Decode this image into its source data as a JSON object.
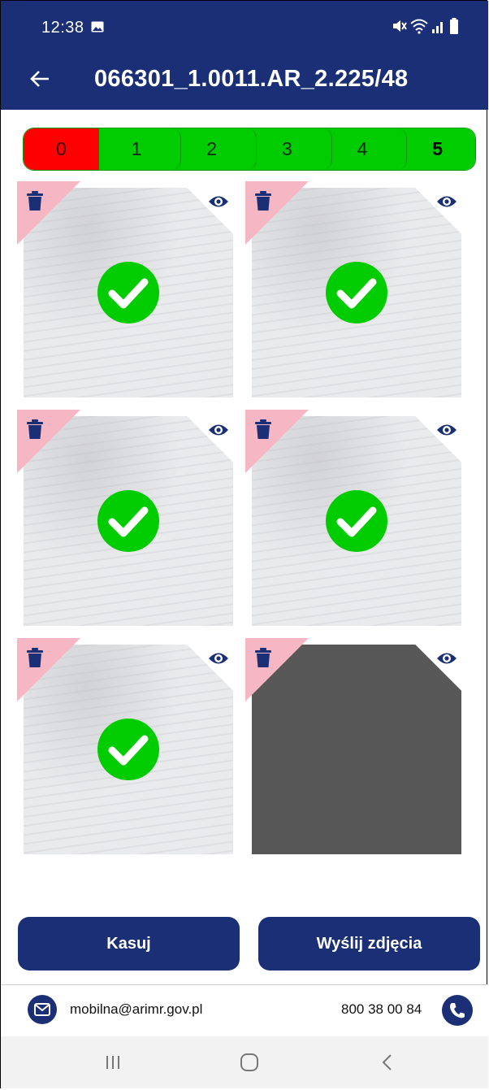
{
  "status_bar": {
    "time": "12:38",
    "icons": [
      "gallery-icon",
      "mute-icon",
      "wifi-icon",
      "signal-icon",
      "battery-icon"
    ]
  },
  "app_bar": {
    "title": "066301_1.0011.AR_2.225/48",
    "back_icon": "arrow-left-icon"
  },
  "progress": {
    "segments": [
      {
        "label": "0",
        "state": "red"
      },
      {
        "label": "1",
        "state": "green"
      },
      {
        "label": "2",
        "state": "green"
      },
      {
        "label": "3",
        "state": "green"
      },
      {
        "label": "4",
        "state": "green"
      },
      {
        "label": "5",
        "state": "green",
        "bold": true
      }
    ],
    "colors": {
      "red": "#ff0000",
      "green": "#00cc00"
    }
  },
  "photos": [
    {
      "approved": true,
      "dark": false
    },
    {
      "approved": true,
      "dark": false
    },
    {
      "approved": true,
      "dark": false
    },
    {
      "approved": true,
      "dark": false
    },
    {
      "approved": true,
      "dark": false
    },
    {
      "approved": false,
      "dark": true
    }
  ],
  "actions": {
    "delete_label": "Kasuj",
    "send_label": "Wyślij zdjęcia"
  },
  "footer": {
    "email": "mobilna@arimr.gov.pl",
    "phone": "800 38 00 84"
  },
  "colors": {
    "primary": "#1b2f76",
    "corner_pink": "#f7b6c3",
    "check_green": "#00cc00"
  }
}
